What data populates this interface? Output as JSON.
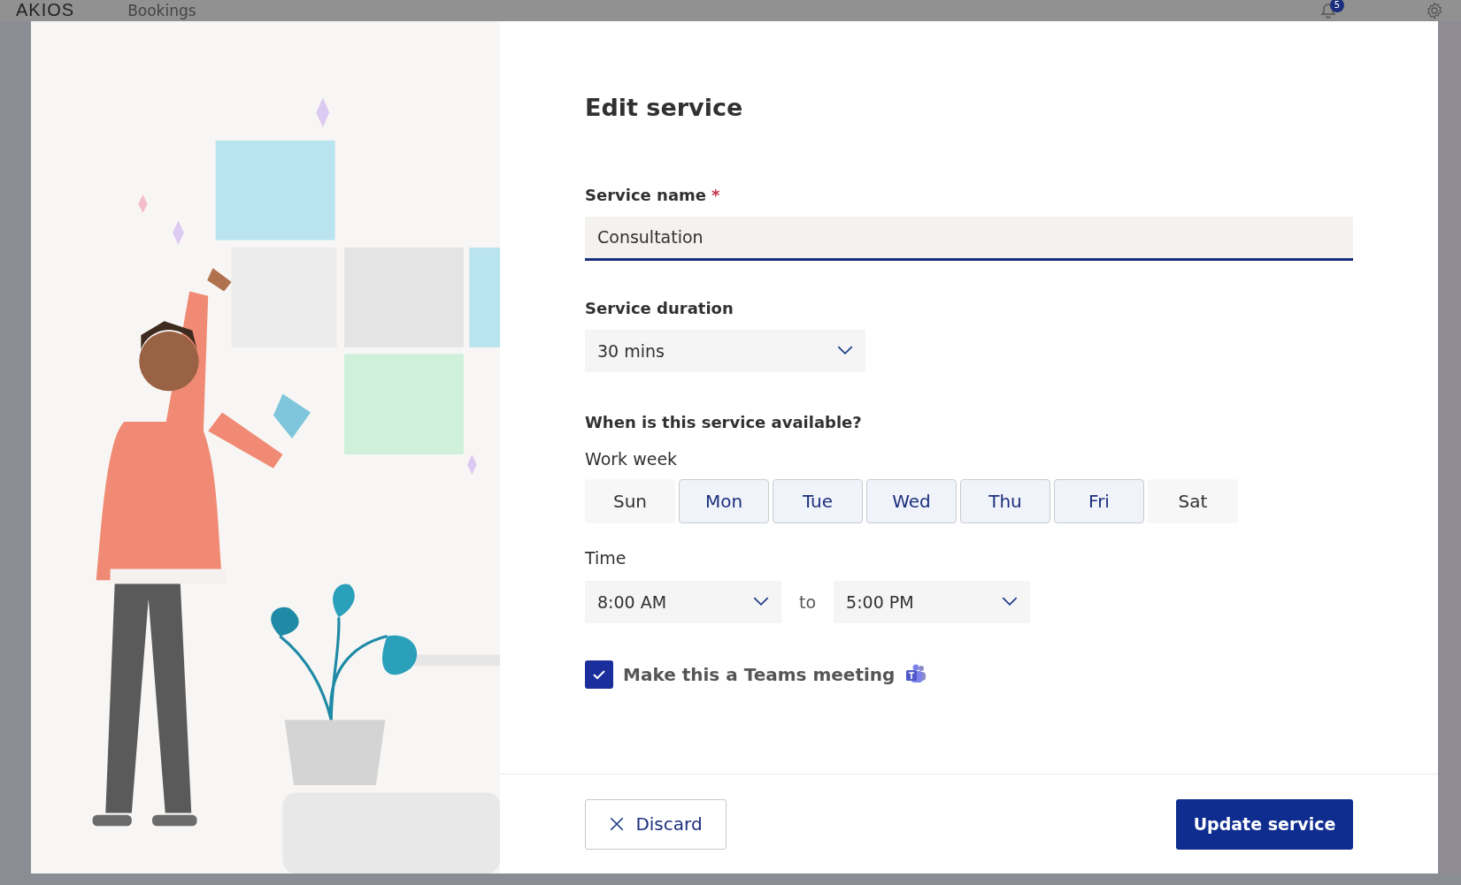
{
  "backdrop": {
    "logo": "AKIOS",
    "app_title": "Bookings",
    "notification_count": "5"
  },
  "dialog": {
    "title": "Edit service",
    "service_name": {
      "label": "Service name",
      "required_mark": "*",
      "value": "Consultation"
    },
    "duration": {
      "label": "Service duration",
      "value": "30 mins"
    },
    "availability": {
      "heading": "When is this service available?",
      "work_week_label": "Work week",
      "days": [
        {
          "label": "Sun",
          "selected": false
        },
        {
          "label": "Mon",
          "selected": true
        },
        {
          "label": "Tue",
          "selected": true
        },
        {
          "label": "Wed",
          "selected": true
        },
        {
          "label": "Thu",
          "selected": true
        },
        {
          "label": "Fri",
          "selected": true
        },
        {
          "label": "Sat",
          "selected": false
        }
      ],
      "time_label": "Time",
      "start": "8:00 AM",
      "separator": "to",
      "end": "5:00 PM"
    },
    "teams_meeting": {
      "label": "Make this a Teams meeting",
      "checked": true
    },
    "buttons": {
      "discard": "Discard",
      "submit": "Update service"
    }
  }
}
